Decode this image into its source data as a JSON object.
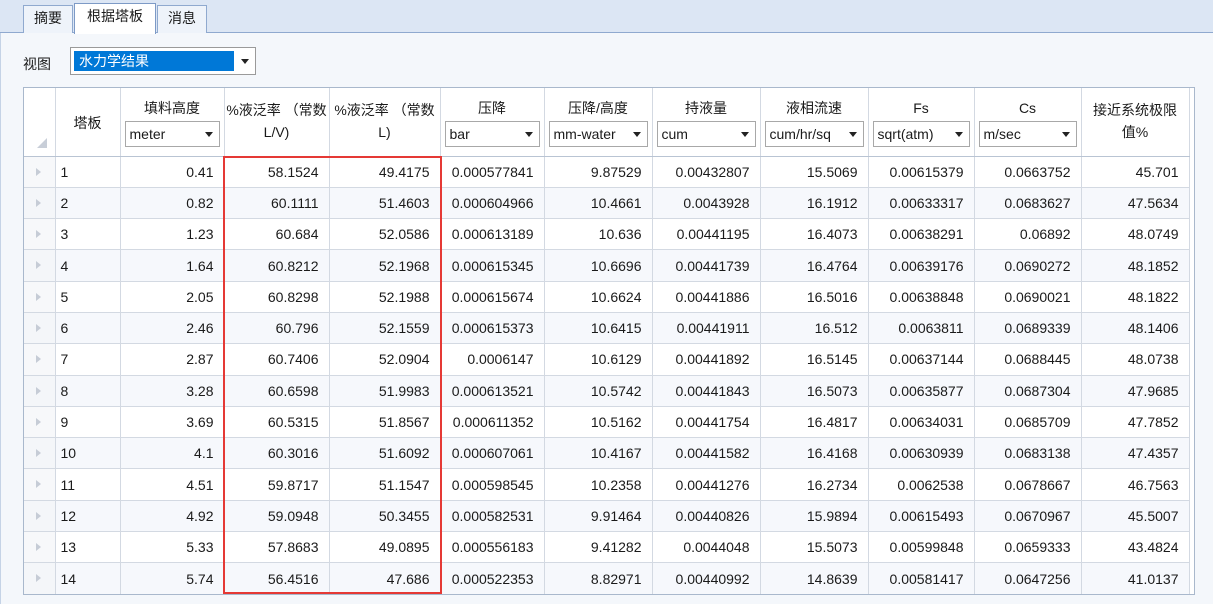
{
  "tabs": [
    {
      "label": "摘要",
      "active": false
    },
    {
      "label": "根据塔板",
      "active": true
    },
    {
      "label": "消息",
      "active": false
    }
  ],
  "view": {
    "label": "视图",
    "selected": "水力学结果"
  },
  "table": {
    "columns": [
      {
        "title": "塔板",
        "unit": null
      },
      {
        "title": "填料高度",
        "unit": "meter"
      },
      {
        "title": "%液泛率 （常数L/V)",
        "unit": null
      },
      {
        "title": "%液泛率 （常数L)",
        "unit": null
      },
      {
        "title": "压降",
        "unit": "bar"
      },
      {
        "title": "压降/高度",
        "unit": "mm-water"
      },
      {
        "title": "持液量",
        "unit": "cum"
      },
      {
        "title": "液相流速",
        "unit": "cum/hr/sq"
      },
      {
        "title": "Fs",
        "unit": "sqrt(atm)"
      },
      {
        "title": "Cs",
        "unit": "m/sec"
      },
      {
        "title": "接近系统极限值%",
        "unit": null
      }
    ],
    "rows": [
      [
        "1",
        "0.41",
        "58.1524",
        "49.4175",
        "0.000577841",
        "9.87529",
        "0.00432807",
        "15.5069",
        "0.00615379",
        "0.0663752",
        "45.701"
      ],
      [
        "2",
        "0.82",
        "60.1111",
        "51.4603",
        "0.000604966",
        "10.4661",
        "0.0043928",
        "16.1912",
        "0.00633317",
        "0.0683627",
        "47.5634"
      ],
      [
        "3",
        "1.23",
        "60.684",
        "52.0586",
        "0.000613189",
        "10.636",
        "0.00441195",
        "16.4073",
        "0.00638291",
        "0.06892",
        "48.0749"
      ],
      [
        "4",
        "1.64",
        "60.8212",
        "52.1968",
        "0.000615345",
        "10.6696",
        "0.00441739",
        "16.4764",
        "0.00639176",
        "0.0690272",
        "48.1852"
      ],
      [
        "5",
        "2.05",
        "60.8298",
        "52.1988",
        "0.000615674",
        "10.6624",
        "0.00441886",
        "16.5016",
        "0.00638848",
        "0.0690021",
        "48.1822"
      ],
      [
        "6",
        "2.46",
        "60.796",
        "52.1559",
        "0.000615373",
        "10.6415",
        "0.00441911",
        "16.512",
        "0.0063811",
        "0.0689339",
        "48.1406"
      ],
      [
        "7",
        "2.87",
        "60.7406",
        "52.0904",
        "0.0006147",
        "10.6129",
        "0.00441892",
        "16.5145",
        "0.00637144",
        "0.0688445",
        "48.0738"
      ],
      [
        "8",
        "3.28",
        "60.6598",
        "51.9983",
        "0.000613521",
        "10.5742",
        "0.00441843",
        "16.5073",
        "0.00635877",
        "0.0687304",
        "47.9685"
      ],
      [
        "9",
        "3.69",
        "60.5315",
        "51.8567",
        "0.000611352",
        "10.5162",
        "0.00441754",
        "16.4817",
        "0.00634031",
        "0.0685709",
        "47.7852"
      ],
      [
        "10",
        "4.1",
        "60.3016",
        "51.6092",
        "0.000607061",
        "10.4167",
        "0.00441582",
        "16.4168",
        "0.00630939",
        "0.0683138",
        "47.4357"
      ],
      [
        "11",
        "4.51",
        "59.8717",
        "51.1547",
        "0.000598545",
        "10.2358",
        "0.00441276",
        "16.2734",
        "0.0062538",
        "0.0678667",
        "46.7563"
      ],
      [
        "12",
        "4.92",
        "59.0948",
        "50.3455",
        "0.000582531",
        "9.91464",
        "0.00440826",
        "15.9894",
        "0.00615493",
        "0.0670967",
        "45.5007"
      ],
      [
        "13",
        "5.33",
        "57.8683",
        "49.0895",
        "0.000556183",
        "9.41282",
        "0.0044048",
        "15.5073",
        "0.00599848",
        "0.0659333",
        "43.4824"
      ],
      [
        "14",
        "5.74",
        "56.4516",
        "47.686",
        "0.000522353",
        "8.82971",
        "0.00440992",
        "14.8639",
        "0.00581417",
        "0.0647256",
        "41.0137"
      ]
    ]
  },
  "colors": {
    "selection": "#0078d7",
    "highlight_border": "#e53935",
    "tab_bar": "#dce6f4"
  }
}
